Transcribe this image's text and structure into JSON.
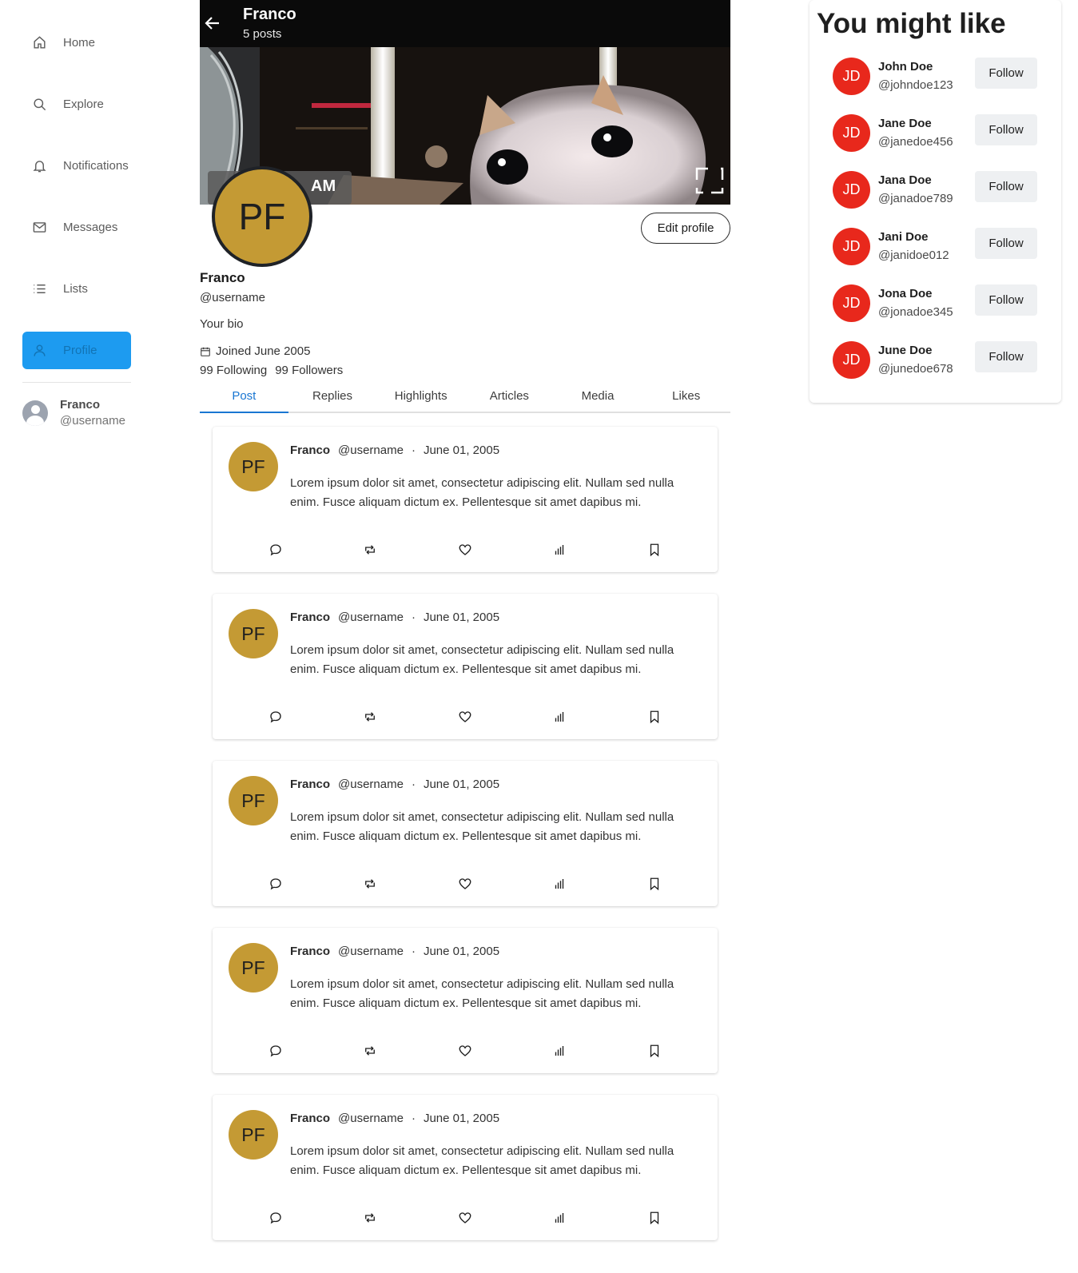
{
  "sidebar": {
    "items": [
      {
        "label": "Home",
        "icon": "home-icon"
      },
      {
        "label": "Explore",
        "icon": "search-icon"
      },
      {
        "label": "Notifications",
        "icon": "bell-icon"
      },
      {
        "label": "Messages",
        "icon": "mail-icon"
      },
      {
        "label": "Lists",
        "icon": "list-icon"
      },
      {
        "label": "Profile",
        "icon": "user-icon",
        "active": true
      }
    ],
    "account": {
      "name": "Franco",
      "handle": "@username"
    }
  },
  "header": {
    "title": "Franco",
    "subtitle": "5 posts"
  },
  "banner": {
    "overlay_text": "AM"
  },
  "profile": {
    "avatar_initials": "PF",
    "name": "Franco",
    "handle": "@username",
    "bio": "Your bio",
    "joined": "Joined June 2005",
    "following": "99 Following",
    "followers": "99 Followers",
    "edit_label": "Edit profile"
  },
  "tabs": [
    {
      "label": "Post",
      "active": true
    },
    {
      "label": "Replies"
    },
    {
      "label": "Highlights"
    },
    {
      "label": "Articles"
    },
    {
      "label": "Media"
    },
    {
      "label": "Likes"
    }
  ],
  "posts": [
    {
      "initials": "PF",
      "author": "Franco",
      "handle": "@username",
      "sep": "·",
      "date": "June 01, 2005",
      "text": "Lorem ipsum dolor sit amet, consectetur adipiscing elit. Nullam sed nulla enim. Fusce aliquam dictum ex. Pellentesque sit amet dapibus mi."
    },
    {
      "initials": "PF",
      "author": "Franco",
      "handle": "@username",
      "sep": "·",
      "date": "June 01, 2005",
      "text": "Lorem ipsum dolor sit amet, consectetur adipiscing elit. Nullam sed nulla enim. Fusce aliquam dictum ex. Pellentesque sit amet dapibus mi."
    },
    {
      "initials": "PF",
      "author": "Franco",
      "handle": "@username",
      "sep": "·",
      "date": "June 01, 2005",
      "text": "Lorem ipsum dolor sit amet, consectetur adipiscing elit. Nullam sed nulla enim. Fusce aliquam dictum ex. Pellentesque sit amet dapibus mi."
    },
    {
      "initials": "PF",
      "author": "Franco",
      "handle": "@username",
      "sep": "·",
      "date": "June 01, 2005",
      "text": "Lorem ipsum dolor sit amet, consectetur adipiscing elit. Nullam sed nulla enim. Fusce aliquam dictum ex. Pellentesque sit amet dapibus mi."
    },
    {
      "initials": "PF",
      "author": "Franco",
      "handle": "@username",
      "sep": "·",
      "date": "June 01, 2005",
      "text": "Lorem ipsum dolor sit amet, consectetur adipiscing elit. Nullam sed nulla enim. Fusce aliquam dictum ex. Pellentesque sit amet dapibus mi."
    }
  ],
  "post_action_icons": [
    "comment-icon",
    "retweet-icon",
    "heart-icon",
    "stats-icon",
    "bookmark-icon"
  ],
  "suggestions": {
    "title": "You might like",
    "follow_label": "Follow",
    "items": [
      {
        "initials": "JD",
        "name": "John Doe",
        "handle": "@johndoe123"
      },
      {
        "initials": "JD",
        "name": "Jane Doe",
        "handle": "@janedoe456"
      },
      {
        "initials": "JD",
        "name": "Jana Doe",
        "handle": "@janadoe789"
      },
      {
        "initials": "JD",
        "name": "Jani Doe",
        "handle": "@janidoe012"
      },
      {
        "initials": "JD",
        "name": "Jona Doe",
        "handle": "@jonadoe345"
      },
      {
        "initials": "JD",
        "name": "June Doe",
        "handle": "@junedoe678"
      }
    ]
  },
  "colors": {
    "accent": "#1d9bf0",
    "tab_active": "#1976d2",
    "avatar_gold": "#c49a34",
    "suggest_avatar": "#e8281c"
  }
}
